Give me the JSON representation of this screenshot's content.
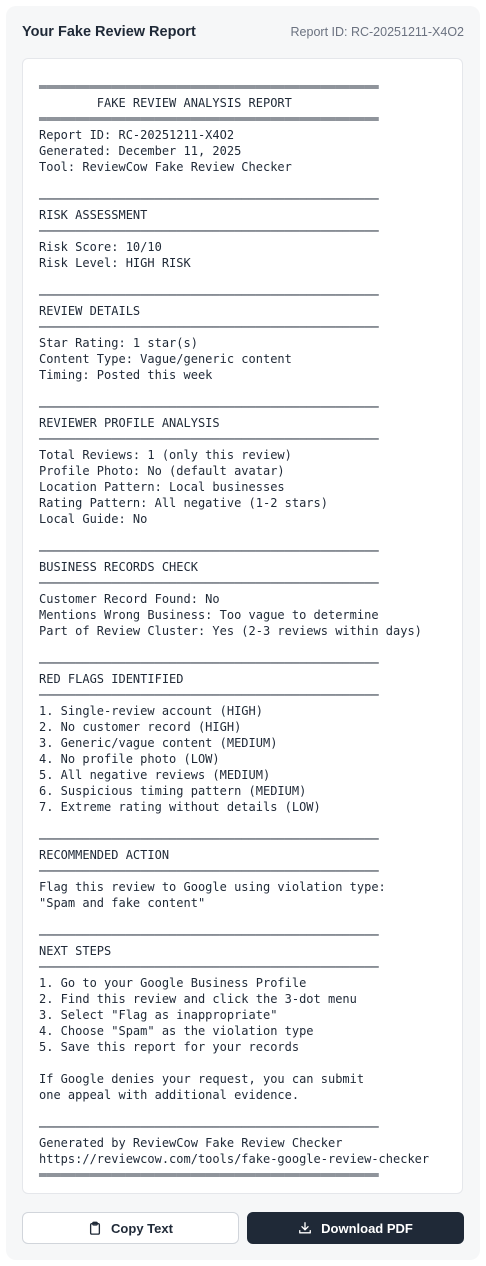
{
  "header": {
    "title": "Your Fake Review Report",
    "report_id": "Report ID: RC-20251211-X4O2"
  },
  "report": {
    "lines": [
      "═══════════════════════════════════════════════",
      "        FAKE REVIEW ANALYSIS REPORT",
      "═══════════════════════════════════════════════",
      "Report ID: RC-20251211-X4O2",
      "Generated: December 11, 2025",
      "Tool: ReviewCow Fake Review Checker",
      "",
      "───────────────────────────────────────────────",
      "RISK ASSESSMENT",
      "───────────────────────────────────────────────",
      "Risk Score: 10/10",
      "Risk Level: HIGH RISK",
      "",
      "───────────────────────────────────────────────",
      "REVIEW DETAILS",
      "───────────────────────────────────────────────",
      "Star Rating: 1 star(s)",
      "Content Type: Vague/generic content",
      "Timing: Posted this week",
      "",
      "───────────────────────────────────────────────",
      "REVIEWER PROFILE ANALYSIS",
      "───────────────────────────────────────────────",
      "Total Reviews: 1 (only this review)",
      "Profile Photo: No (default avatar)",
      "Location Pattern: Local businesses",
      "Rating Pattern: All negative (1-2 stars)",
      "Local Guide: No",
      "",
      "───────────────────────────────────────────────",
      "BUSINESS RECORDS CHECK",
      "───────────────────────────────────────────────",
      "Customer Record Found: No",
      "Mentions Wrong Business: Too vague to determine",
      "Part of Review Cluster: Yes (2-3 reviews within days)",
      "",
      "───────────────────────────────────────────────",
      "RED FLAGS IDENTIFIED",
      "───────────────────────────────────────────────",
      "1. Single-review account (HIGH)",
      "2. No customer record (HIGH)",
      "3. Generic/vague content (MEDIUM)",
      "4. No profile photo (LOW)",
      "5. All negative reviews (MEDIUM)",
      "6. Suspicious timing pattern (MEDIUM)",
      "7. Extreme rating without details (LOW)",
      "",
      "───────────────────────────────────────────────",
      "RECOMMENDED ACTION",
      "───────────────────────────────────────────────",
      "Flag this review to Google using violation type:",
      "\"Spam and fake content\"",
      "",
      "───────────────────────────────────────────────",
      "NEXT STEPS",
      "───────────────────────────────────────────────",
      "1. Go to your Google Business Profile",
      "2. Find this review and click the 3-dot menu",
      "3. Select \"Flag as inappropriate\"",
      "4. Choose \"Spam\" as the violation type",
      "5. Save this report for your records",
      "",
      "If Google denies your request, you can submit",
      "one appeal with additional evidence.",
      "",
      "───────────────────────────────────────────────",
      "Generated by ReviewCow Fake Review Checker",
      "https://reviewcow.com/tools/fake-google-review-checker",
      "═══════════════════════════════════════════════"
    ]
  },
  "actions": {
    "copy_label": "Copy Text",
    "copy_icon": "clipboard-icon",
    "pdf_label": "Download PDF",
    "pdf_icon": "download-icon"
  },
  "colors": {
    "primary_dark": "#1f2937",
    "muted_text": "#6b7280",
    "panel_bg": "#f6f7f8"
  }
}
